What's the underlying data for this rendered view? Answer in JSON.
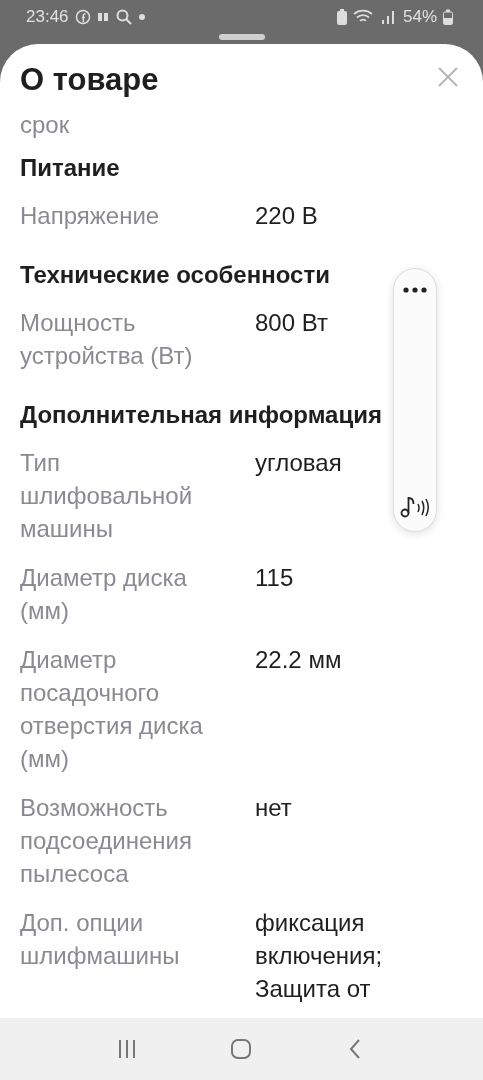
{
  "status_bar": {
    "time": "23:46",
    "battery": "54%"
  },
  "sheet": {
    "title": "О товаре",
    "continued_text": "срок",
    "sections": [
      {
        "heading": "Питание",
        "rows": [
          {
            "label": "Напряжение",
            "value": "220 В"
          }
        ]
      },
      {
        "heading": "Технические особенности",
        "rows": [
          {
            "label": "Мощность устройства (Вт)",
            "value": "800 Вт"
          }
        ]
      },
      {
        "heading": "Дополнительная информация",
        "rows": [
          {
            "label": "Тип шлифовальной машины",
            "value": "угловая"
          },
          {
            "label": "Диаметр диска (мм)",
            "value": "115"
          },
          {
            "label": "Диаметр посадочного отверстия диска (мм)",
            "value": "22.2 мм"
          },
          {
            "label": "Возможность подсоединения пылесоса",
            "value": "нет"
          },
          {
            "label": "Доп. опции шлифмашины",
            "value": "фиксация включения; Защита от"
          }
        ]
      }
    ]
  }
}
